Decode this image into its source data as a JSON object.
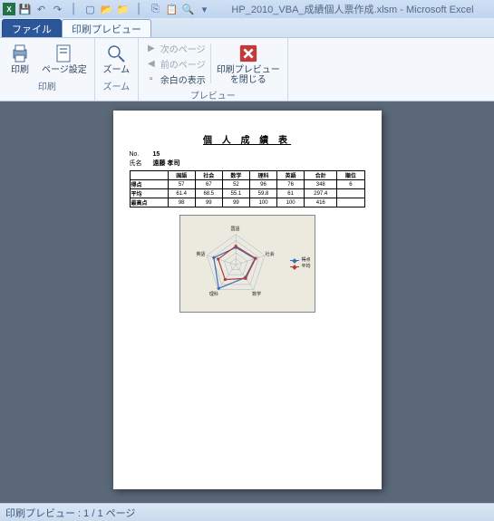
{
  "titlebar": {
    "app_icon_letter": "X",
    "filename": "HP_2010_VBA_成績個人票作成.xlsm",
    "app_name": "Microsoft Excel"
  },
  "tabs": {
    "file": "ファイル",
    "preview": "印刷プレビュー"
  },
  "ribbon": {
    "print": "印刷",
    "page_setup": "ページ設定",
    "group_print": "印刷",
    "zoom": "ズーム",
    "group_zoom": "ズーム",
    "next_page": "次のページ",
    "prev_page": "前のページ",
    "show_margins": "余白の表示",
    "group_preview": "プレビュー",
    "close_preview_l1": "印刷プレビュー",
    "close_preview_l2": "を閉じる"
  },
  "doc": {
    "title": "個 人 成 績 表",
    "meta_no_label": "No.",
    "meta_no_value": "15",
    "meta_name_label": "氏名",
    "meta_name_value": "遠藤 孝司",
    "table": {
      "cols": [
        "",
        "国語",
        "社会",
        "数学",
        "理科",
        "英語",
        "合計",
        "順位"
      ],
      "rows": [
        {
          "head": "得点",
          "cells": [
            "57",
            "67",
            "52",
            "96",
            "76",
            "348",
            "6"
          ]
        },
        {
          "head": "平均",
          "cells": [
            "61.4",
            "68.5",
            "55.1",
            "59.8",
            "61",
            "297.4",
            ""
          ]
        },
        {
          "head": "最高点",
          "cells": [
            "98",
            "99",
            "99",
            "100",
            "100",
            "416",
            ""
          ]
        }
      ]
    }
  },
  "chart_data": {
    "type": "radar",
    "categories": [
      "国語",
      "社会",
      "数学",
      "理科",
      "英語"
    ],
    "series": [
      {
        "name": "得点",
        "values": [
          57,
          67,
          52,
          96,
          76
        ]
      },
      {
        "name": "平均",
        "values": [
          61.4,
          68.5,
          55.1,
          59.8,
          61
        ]
      }
    ],
    "max": 100
  },
  "status": "印刷プレビュー : 1 / 1 ページ"
}
